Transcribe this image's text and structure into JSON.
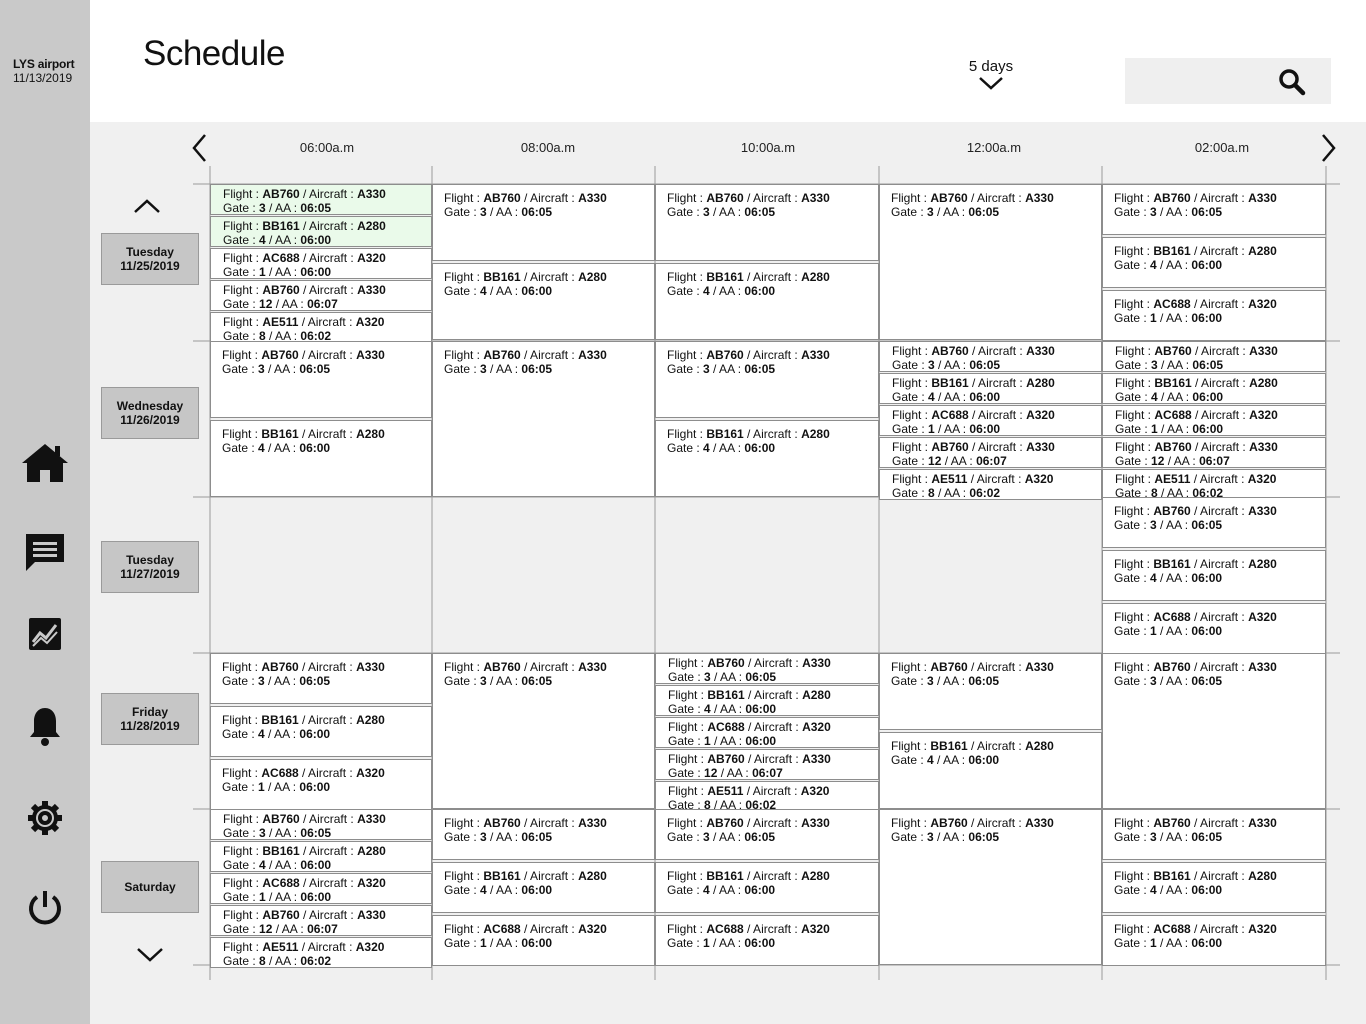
{
  "sidebar": {
    "airport_name": "LYS airport",
    "date": "11/13/2019",
    "nav": [
      "home-icon",
      "chat-icon",
      "analytics-icon",
      "bell-icon",
      "gear-icon",
      "power-icon"
    ]
  },
  "header": {
    "title": "Schedule",
    "range_label": "5 days",
    "search_placeholder": ""
  },
  "timeline": {
    "times": [
      "06:00a.m",
      "08:00a.m",
      "10:00a.m",
      "12:00a.m",
      "02:00a.m"
    ]
  },
  "days": [
    {
      "name": "Tuesday",
      "date": "11/25/2019"
    },
    {
      "name": "Wednesday",
      "date": "11/26/2019"
    },
    {
      "name": "Tuesday",
      "date": "11/27/2019"
    },
    {
      "name": "Friday",
      "date": "11/28/2019"
    },
    {
      "name": "Saturday",
      "date": ""
    }
  ],
  "flight_text": {
    "flight_label": "Flight : ",
    "aircraft_label": " / Aircraft : ",
    "gate_label": "Gate : ",
    "aa_label": " / AA : "
  },
  "flight_types": [
    {
      "flight": "AB760",
      "aircraft": "A330",
      "gate": "3",
      "aa": "06:05"
    },
    {
      "flight": "BB161",
      "aircraft": "A280",
      "gate": "4",
      "aa": "06:00"
    },
    {
      "flight": "AC688",
      "aircraft": "A320",
      "gate": "1",
      "aa": "06:00"
    },
    {
      "flight": "AB760",
      "aircraft": "A330",
      "gate": "12",
      "aa": "06:07"
    },
    {
      "flight": "AE511",
      "aircraft": "A320",
      "gate": "8",
      "aa": "06:02"
    }
  ],
  "slots": [
    {
      "day": 0,
      "col": 0,
      "flights": [
        0,
        1,
        2,
        3,
        4
      ],
      "highlight": [
        0,
        1
      ]
    },
    {
      "day": 0,
      "col": 1,
      "flights": [
        0,
        1
      ]
    },
    {
      "day": 0,
      "col": 2,
      "flights": [
        0,
        1
      ]
    },
    {
      "day": 0,
      "col": 3,
      "flights": [
        0
      ]
    },
    {
      "day": 0,
      "col": 4,
      "flights": [
        0,
        1,
        2
      ]
    },
    {
      "day": 1,
      "col": 0,
      "flights": [
        0,
        1
      ]
    },
    {
      "day": 1,
      "col": 1,
      "flights": [
        0
      ]
    },
    {
      "day": 1,
      "col": 2,
      "flights": [
        0,
        1
      ]
    },
    {
      "day": 1,
      "col": 3,
      "flights": [
        0,
        1,
        2,
        3,
        4
      ]
    },
    {
      "day": 1,
      "col": 4,
      "flights": [
        0,
        1,
        2,
        3,
        4
      ]
    },
    {
      "day": 2,
      "col": 4,
      "flights": [
        0,
        1,
        2
      ]
    },
    {
      "day": 3,
      "col": 0,
      "flights": [
        0,
        1,
        2
      ]
    },
    {
      "day": 3,
      "col": 1,
      "flights": [
        0
      ]
    },
    {
      "day": 3,
      "col": 2,
      "flights": [
        0,
        1,
        2,
        3,
        4
      ]
    },
    {
      "day": 3,
      "col": 3,
      "flights": [
        0,
        1
      ]
    },
    {
      "day": 3,
      "col": 4,
      "flights": [
        0
      ]
    },
    {
      "day": 4,
      "col": 0,
      "flights": [
        0,
        1,
        2,
        3,
        4
      ]
    },
    {
      "day": 4,
      "col": 1,
      "flights": [
        0,
        1,
        2
      ]
    },
    {
      "day": 4,
      "col": 2,
      "flights": [
        0,
        1,
        2
      ]
    },
    {
      "day": 4,
      "col": 3,
      "flights": [
        0
      ]
    },
    {
      "day": 4,
      "col": 4,
      "flights": [
        0,
        1,
        2
      ]
    }
  ]
}
